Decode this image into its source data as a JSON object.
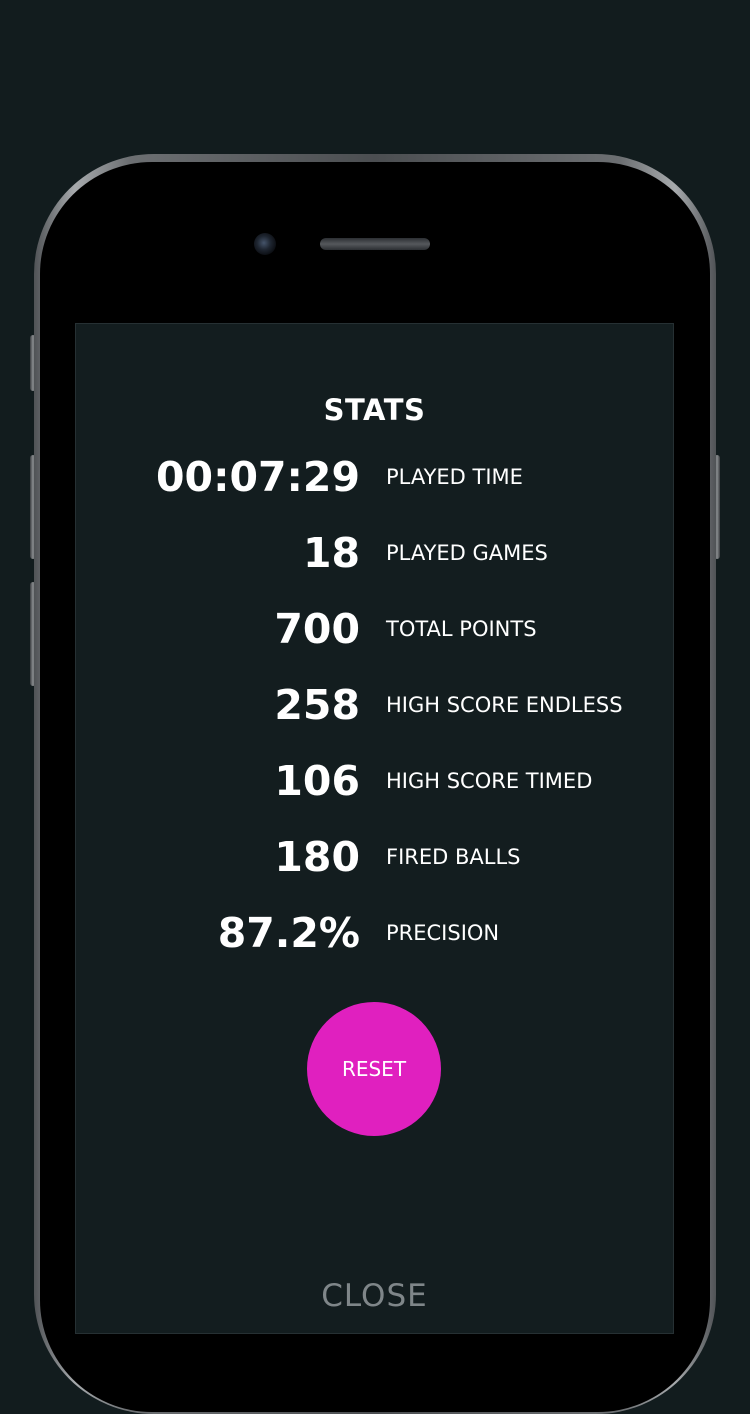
{
  "screen": {
    "title": "STATS",
    "stats": [
      {
        "value": "00:07:29",
        "label": "PLAYED TIME"
      },
      {
        "value": "18",
        "label": "PLAYED GAMES"
      },
      {
        "value": "700",
        "label": "TOTAL POINTS"
      },
      {
        "value": "258",
        "label": "HIGH SCORE ENDLESS"
      },
      {
        "value": "106",
        "label": "HIGH SCORE TIMED"
      },
      {
        "value": "180",
        "label": "FIRED BALLS"
      },
      {
        "value": "87.2%",
        "label": "PRECISION"
      }
    ],
    "reset_label": "RESET",
    "close_label": "CLOSE"
  },
  "colors": {
    "background": "#121c1e",
    "screen": "#131d1f",
    "accent": "#e020bf",
    "text": "#ffffff",
    "muted": "#7f8689"
  }
}
